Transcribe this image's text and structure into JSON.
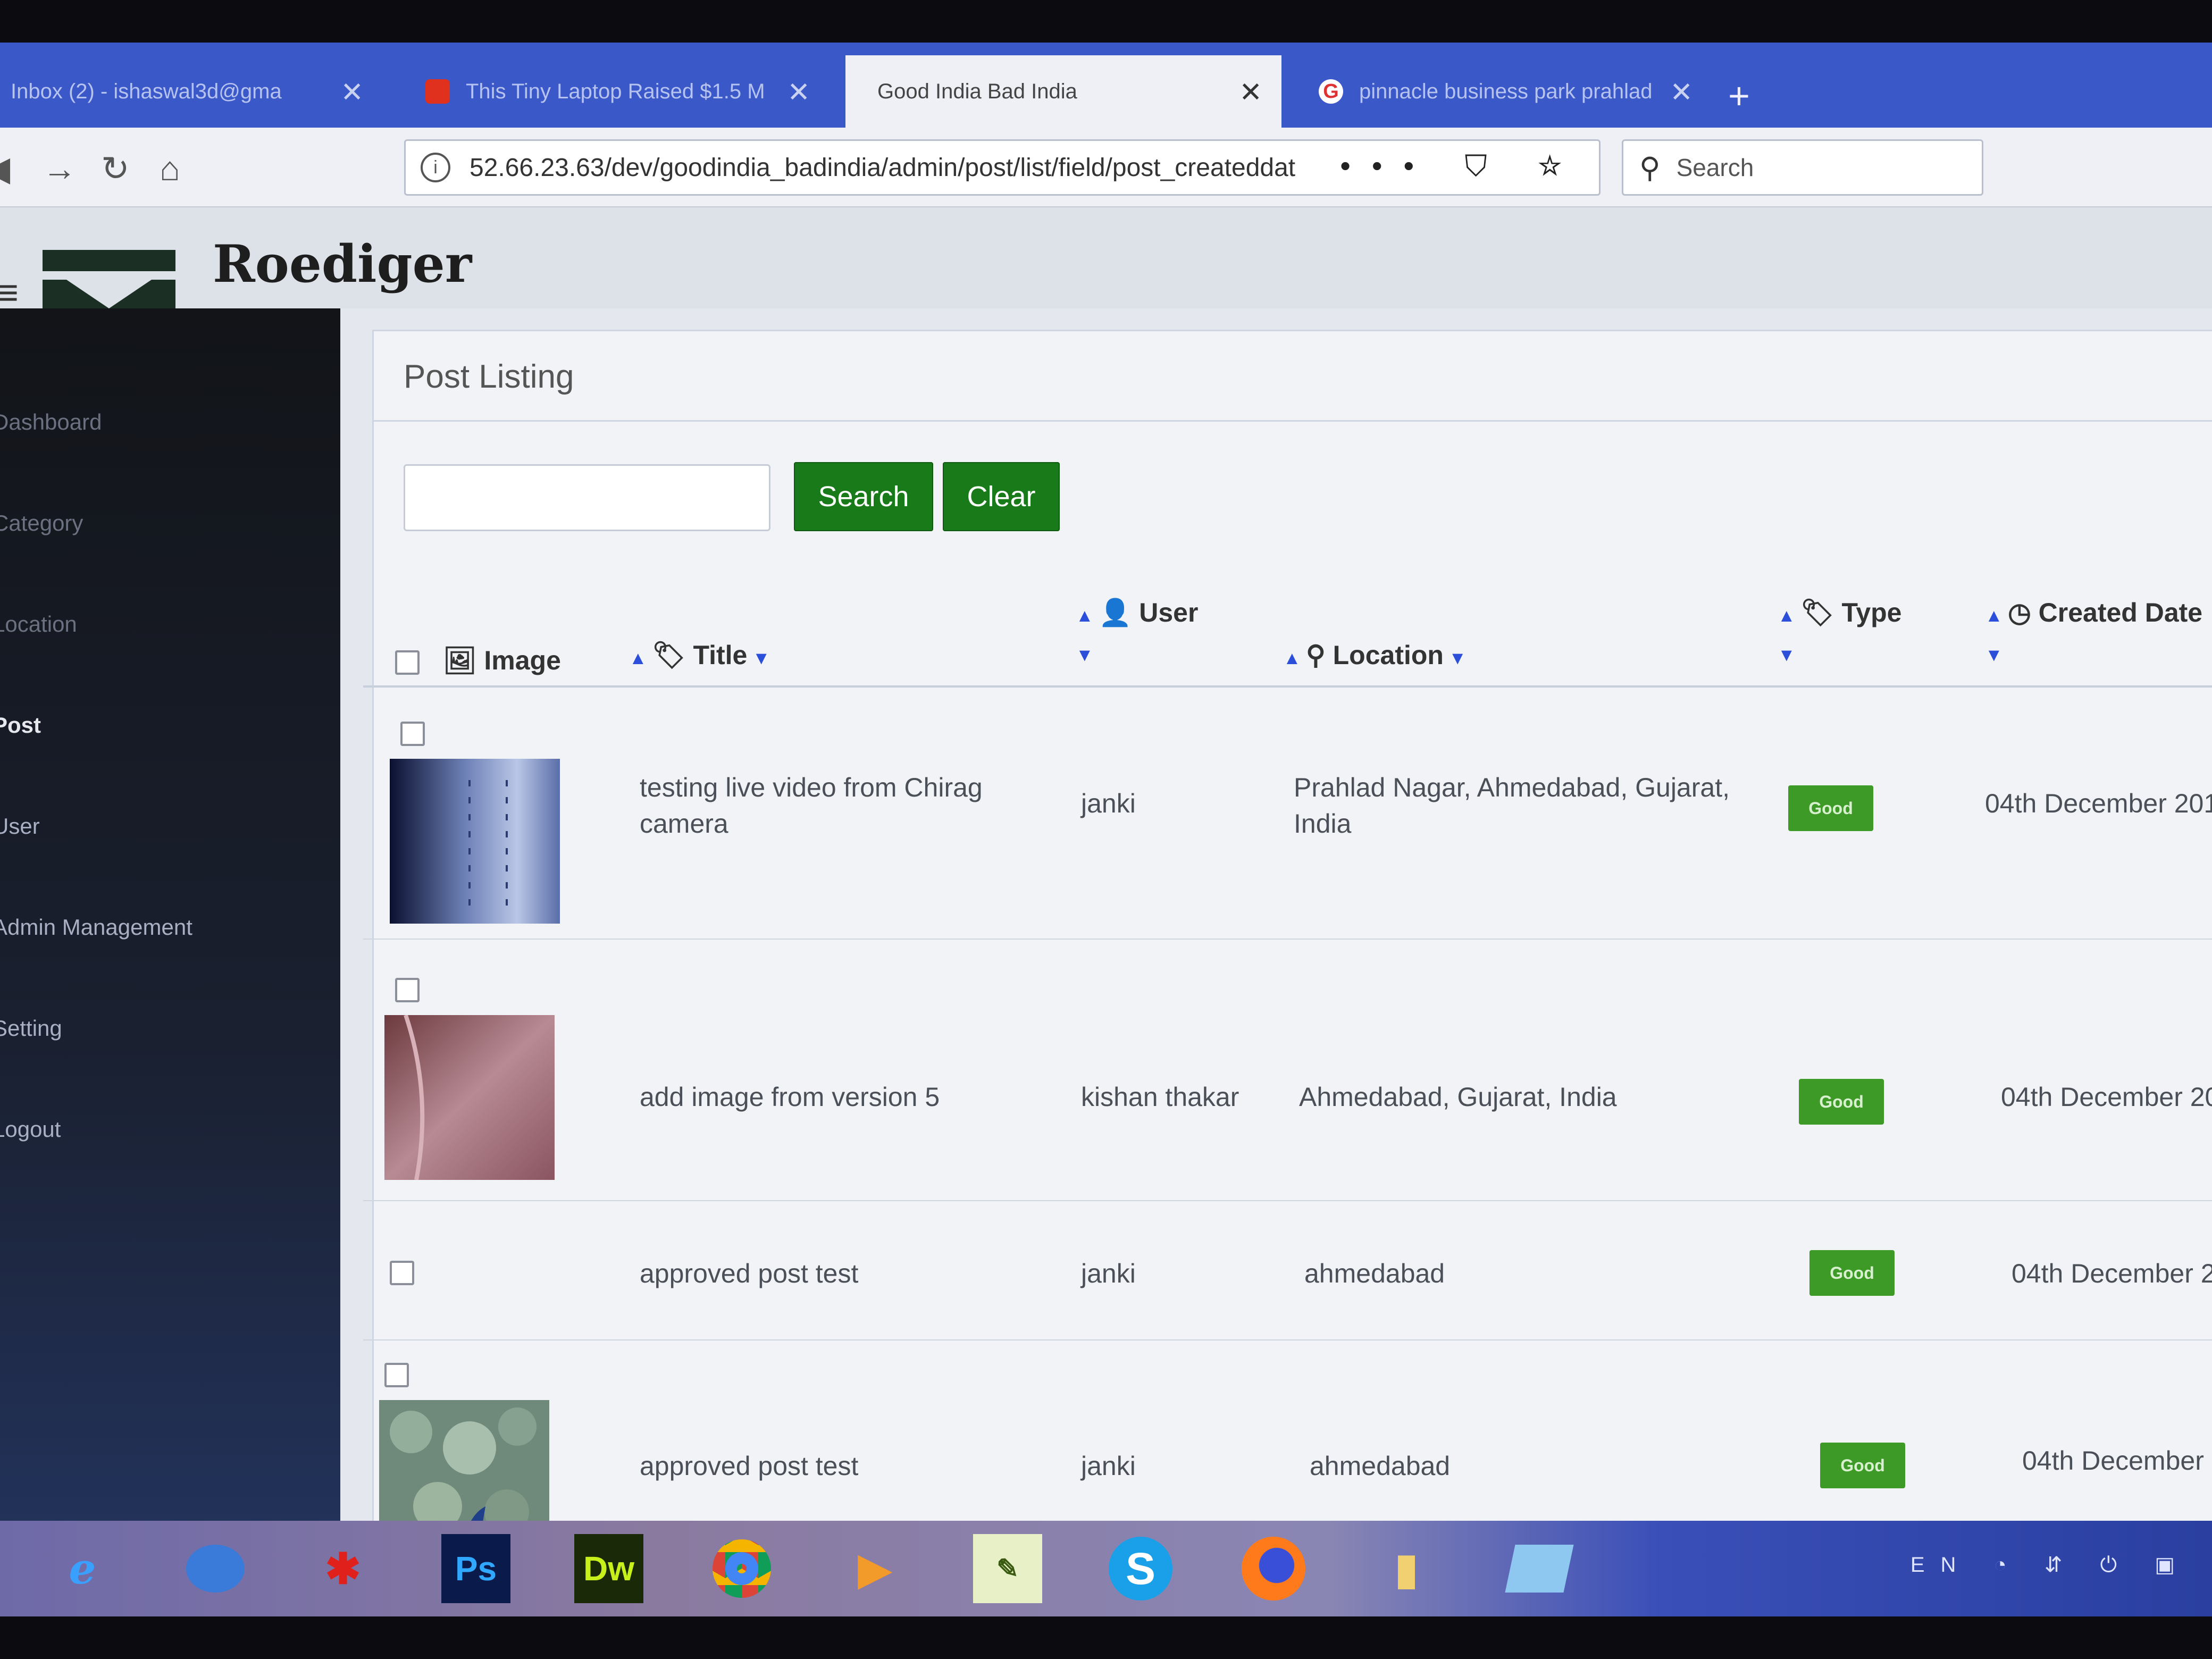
{
  "browser": {
    "tabs": [
      {
        "label": "Inbox (2) - ishaswal3d@gma",
        "active": false
      },
      {
        "label": "This Tiny Laptop Raised $1.5 M",
        "active": false
      },
      {
        "label": "Good India Bad India",
        "active": true
      },
      {
        "label": "pinnacle business park prahlad",
        "active": false
      }
    ],
    "close_glyph": "✕",
    "new_tab_glyph": "+",
    "url": "52.66.23.63/dev/goodindia_badindia/admin/post/list/field/post_createddat",
    "url_actions": "••• ⛉ ☆",
    "search_placeholder": "Search"
  },
  "app": {
    "brand": "Roediger"
  },
  "sidebar": {
    "items": [
      {
        "label": "Dashboard"
      },
      {
        "label": "Category"
      },
      {
        "label": "Location"
      },
      {
        "label": "Post"
      },
      {
        "label": "User"
      },
      {
        "label": "Admin Management"
      },
      {
        "label": "Setting"
      },
      {
        "label": "Logout"
      }
    ]
  },
  "panel": {
    "title": "Post Listing",
    "search_button": "Search",
    "clear_button": "Clear"
  },
  "table": {
    "headers": {
      "image": "Image",
      "title": "Title",
      "user": "User",
      "location": "Location",
      "type": "Type",
      "created": "Created Date"
    },
    "rows": [
      {
        "title": "testing live video from Chirag camera",
        "user": "janki",
        "location": "Prahlad Nagar, Ahmedabad, Gujarat, India",
        "type": "Good",
        "created": "04th December 201",
        "thumb": "video"
      },
      {
        "title": "add image from version 5",
        "user": "kishan thakar",
        "location": "Ahmedabad, Gujarat, India",
        "type": "Good",
        "created": "04th December 20",
        "thumb": "fabric"
      },
      {
        "title": "approved post test",
        "user": "janki",
        "location": "ahmedabad",
        "type": "Good",
        "created": "04th December 2",
        "thumb": "none"
      },
      {
        "title": "approved post test",
        "user": "janki",
        "location": "ahmedabad",
        "type": "Good",
        "created": "04th December",
        "thumb": "peacock"
      }
    ]
  },
  "taskbar": {
    "apps": [
      "Internet Explorer",
      "Thunderbird",
      "Paint",
      "Ps",
      "Dw",
      "Chrome",
      "Media Player",
      "Notepad",
      "Skype",
      "Firefox",
      "File Explorer",
      "Window"
    ],
    "tray": "EN ◔ ⇵ ⏻ ▣"
  },
  "colors": {
    "accent_green": "#187a18",
    "badge_green": "#3d9a26",
    "sort_blue": "#2b4fd8",
    "tabbar_blue": "#3a58c8"
  }
}
